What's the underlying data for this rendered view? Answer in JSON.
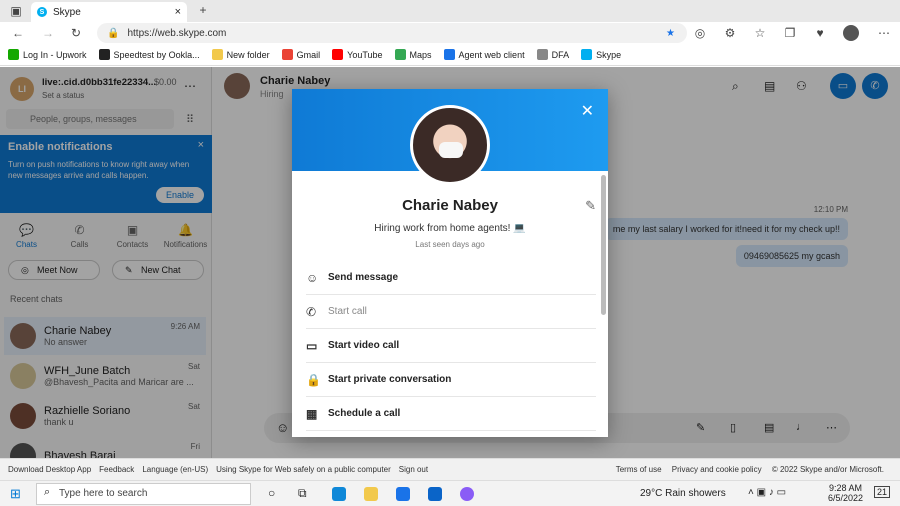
{
  "browser": {
    "tab_title": "Skype",
    "url": "https://web.skype.com",
    "bookmarks": [
      {
        "label": "Log In - Upwork",
        "color": "#14a800"
      },
      {
        "label": "Speedtest by Ookla...",
        "color": "#222222"
      },
      {
        "label": "New folder",
        "color": "#f2c94c"
      },
      {
        "label": "Gmail",
        "color": "#ea4335"
      },
      {
        "label": "YouTube",
        "color": "#ff0000"
      },
      {
        "label": "Maps",
        "color": "#34a853"
      },
      {
        "label": "Agent web client",
        "color": "#1a73e8"
      },
      {
        "label": "DFA",
        "color": "#888888"
      },
      {
        "label": "Skype",
        "color": "#00aff0"
      }
    ]
  },
  "sidebar": {
    "me": {
      "initials": "LI",
      "name": "live:.cid.d0bb31fe22334...",
      "balance": "$0.00",
      "status": "Set a status"
    },
    "search_placeholder": "People, groups, messages",
    "notification": {
      "title": "Enable notifications",
      "body": "Turn on push notifications to know right away when new messages arrive and calls happen.",
      "button": "Enable"
    },
    "tabs": [
      "Chats",
      "Calls",
      "Contacts",
      "Notifications"
    ],
    "meet_now": "Meet Now",
    "new_chat": "New Chat",
    "recent_label": "Recent chats",
    "chats": [
      {
        "name": "Charie Nabey",
        "sub": "No answer",
        "time": "9:26 AM"
      },
      {
        "name": "WFH_June Batch",
        "sub": "@Bhavesh_Pacita and Maricar are ...",
        "time": "Sat"
      },
      {
        "name": "Razhielle Soriano",
        "sub": "thank u",
        "time": "Sat"
      },
      {
        "name": "Bhavesh Barai",
        "sub": "",
        "time": "Fri"
      }
    ]
  },
  "main": {
    "header_name": "Charie Nabey",
    "header_sub": "Hiring",
    "time_label": "12:10 PM",
    "messages": [
      "me my last salary I worked for it!need it for my check up!!",
      "09469085625 my gcash"
    ]
  },
  "profile": {
    "name": "Charie Nabey",
    "status": "Hiring work from home agents! 💻",
    "last_seen": "Last seen days ago",
    "actions": [
      {
        "label": "Send message",
        "icon": "message-icon",
        "glyph": "☺",
        "disabled": false
      },
      {
        "label": "Start call",
        "icon": "phone-icon",
        "glyph": "✆",
        "disabled": true
      },
      {
        "label": "Start video call",
        "icon": "video-icon",
        "glyph": "▭",
        "disabled": false
      },
      {
        "label": "Start private conversation",
        "icon": "lock-icon",
        "glyph": "🔒",
        "disabled": false
      },
      {
        "label": "Schedule a call",
        "icon": "calendar-icon",
        "glyph": "▦",
        "disabled": false
      }
    ]
  },
  "footer": {
    "left": [
      "Download Desktop App",
      "Feedback",
      "Language (en-US)",
      "Using Skype for Web safely on a public computer",
      "Sign out"
    ],
    "right": [
      "Terms of use",
      "Privacy and cookie policy",
      "© 2022 Skype and/or Microsoft."
    ]
  },
  "taskbar": {
    "search_placeholder": "Type here to search",
    "weather": "29°C  Rain showers",
    "time": "9:28 AM",
    "date": "6/5/2022",
    "notification_count": "21"
  }
}
